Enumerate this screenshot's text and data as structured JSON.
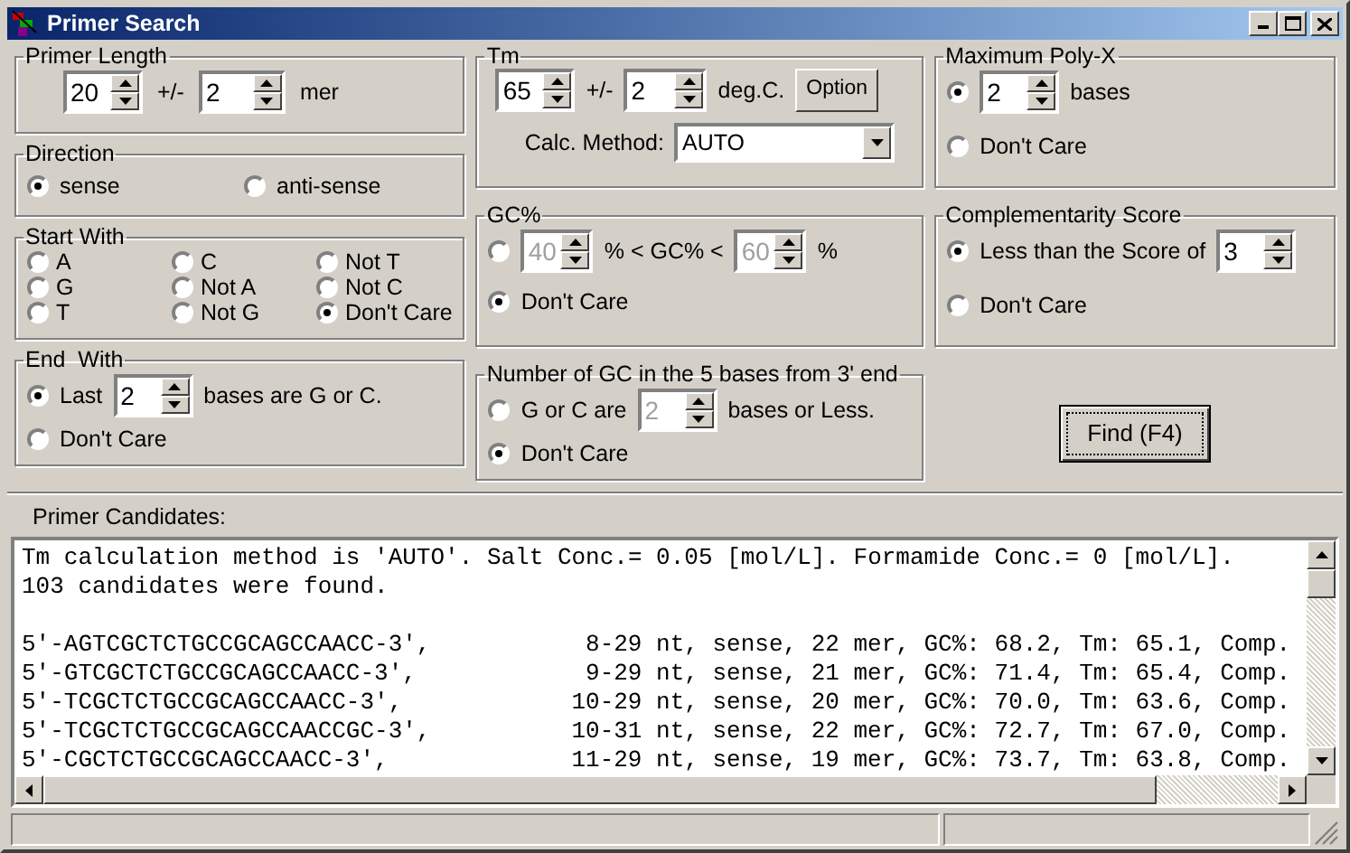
{
  "window": {
    "title": "Primer Search"
  },
  "primer_length": {
    "title": "Primer Length",
    "value": "20",
    "separator": "+/-",
    "tolerance": "2",
    "unit": "mer"
  },
  "direction": {
    "title": "Direction",
    "options": [
      {
        "label": "sense",
        "selected": true
      },
      {
        "label": "anti-sense",
        "selected": false
      }
    ]
  },
  "start_with": {
    "title": "Start With",
    "options": [
      {
        "label": "A",
        "selected": false
      },
      {
        "label": "C",
        "selected": false
      },
      {
        "label": "Not T",
        "selected": false
      },
      {
        "label": "G",
        "selected": false
      },
      {
        "label": "Not A",
        "selected": false
      },
      {
        "label": "Not C",
        "selected": false
      },
      {
        "label": "T",
        "selected": false
      },
      {
        "label": "Not G",
        "selected": false
      },
      {
        "label": "Don't Care",
        "selected": true
      }
    ]
  },
  "end_with": {
    "title": "End  With",
    "options": [
      {
        "kind": "spin",
        "label": "Last",
        "value": "2",
        "suffix": "bases are G or C.",
        "selected": true
      },
      {
        "kind": "plain",
        "label": "Don't Care",
        "selected": false
      }
    ]
  },
  "tm": {
    "title": "Tm",
    "value": "65",
    "separator": "+/-",
    "tolerance": "2",
    "unit": "deg.C.",
    "option_button": "Option",
    "method_label": "Calc. Method:",
    "method": "AUTO"
  },
  "gc_percent": {
    "title": "GC%",
    "options": [
      {
        "kind": "range",
        "low": "40",
        "middle": "% < GC% <",
        "high": "60",
        "suffix": "%",
        "selected": false
      },
      {
        "kind": "plain",
        "label": "Don't Care",
        "selected": true
      }
    ]
  },
  "gc_3prime": {
    "title": "Number of GC in the 5 bases from 3' end",
    "options": [
      {
        "kind": "spin",
        "label": "G or C are",
        "value": "2",
        "suffix": "bases or Less.",
        "selected": false
      },
      {
        "kind": "plain",
        "label": "Don't Care",
        "selected": true
      }
    ]
  },
  "poly_x": {
    "title": "Maximum Poly-X",
    "options": [
      {
        "kind": "spin",
        "value": "2",
        "suffix": "bases",
        "selected": true
      },
      {
        "kind": "plain",
        "label": "Don't Care",
        "selected": false
      }
    ]
  },
  "complementarity": {
    "title": "Complementarity Score",
    "options": [
      {
        "kind": "spin",
        "label": "Less than the Score of",
        "value": "3",
        "selected": true
      },
      {
        "kind": "plain",
        "label": "Don't Care",
        "selected": false
      }
    ]
  },
  "find_button": "Find (F4)",
  "candidates": {
    "label": "Primer Candidates:",
    "header": [
      "Tm calculation method is 'AUTO'. Salt Conc.= 0.05 [mol/L]. Formamide Conc.= 0 [mol/L].",
      "103 candidates were found."
    ],
    "rows": [
      {
        "sequence": "5'-AGTCGCTCTGCCGCAGCCAACC-3',",
        "range": "8-29",
        "details": "nt, sense, 22 mer, GC%: 68.2, Tm: 65.1, Comp."
      },
      {
        "sequence": "5'-GTCGCTCTGCCGCAGCCAACC-3',",
        "range": "9-29",
        "details": "nt, sense, 21 mer, GC%: 71.4, Tm: 65.4, Comp."
      },
      {
        "sequence": "5'-TCGCTCTGCCGCAGCCAACC-3',",
        "range": "10-29",
        "details": "nt, sense, 20 mer, GC%: 70.0, Tm: 63.6, Comp."
      },
      {
        "sequence": "5'-TCGCTCTGCCGCAGCCAACCGC-3',",
        "range": "10-31",
        "details": "nt, sense, 22 mer, GC%: 72.7, Tm: 67.0, Comp."
      },
      {
        "sequence": "5'-CGCTCTGCCGCAGCCAACC-3',",
        "range": "11-29",
        "details": "nt, sense, 19 mer, GC%: 73.7, Tm: 63.8, Comp."
      }
    ]
  }
}
